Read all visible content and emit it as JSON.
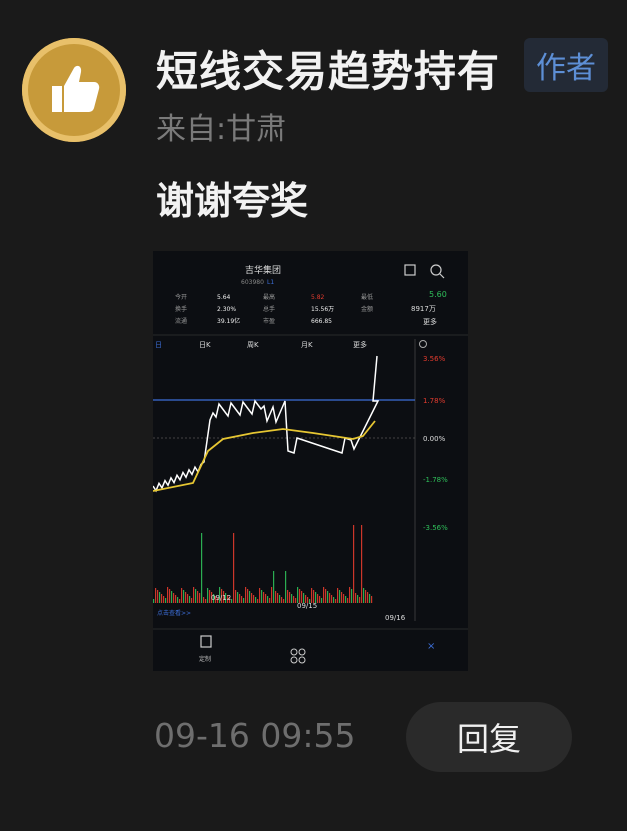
{
  "comment": {
    "user": {
      "name": "短线交易趋势持有",
      "badge": "作者",
      "location": "来自:甘肃",
      "avatar_icon": "thumbs-up-icon"
    },
    "text": "谢谢夸奖",
    "timestamp": "09-16 09:55",
    "reply_label": "回复"
  },
  "photo": {
    "stock_name": "吉华集团",
    "stock_code": "603980",
    "market_tag": "L1",
    "quote_rows": [
      [
        "今开",
        "5.64",
        "最高",
        "5.82",
        "最低"
      ],
      [
        "换手",
        "2.30%",
        "总手",
        "15.56万",
        "金额"
      ],
      [
        "流通",
        "39.19亿",
        "市盈",
        "666.85",
        ""
      ]
    ],
    "right_price": "5.60",
    "right_amount": "8917万",
    "more_label": "更多",
    "tabs": [
      "日",
      "日K",
      "周K",
      "月K",
      "更多"
    ],
    "pct_labels": [
      "3.56%",
      "1.78%",
      "0.00%",
      "-1.78%",
      "-3.56%"
    ],
    "date_labels": [
      "09/12",
      "09/15",
      "09/16"
    ],
    "link_text": "点击查看>>",
    "bottom_icons": [
      "edit-icon",
      "grid-icon"
    ],
    "bottom_labels": [
      "定制",
      "我的"
    ],
    "colors": {
      "price_line": "#ffffff",
      "avg_line": "#e6c632",
      "ref_line": "#3d6fd8",
      "up": "#e23b2e",
      "down": "#2fbf5a"
    }
  }
}
